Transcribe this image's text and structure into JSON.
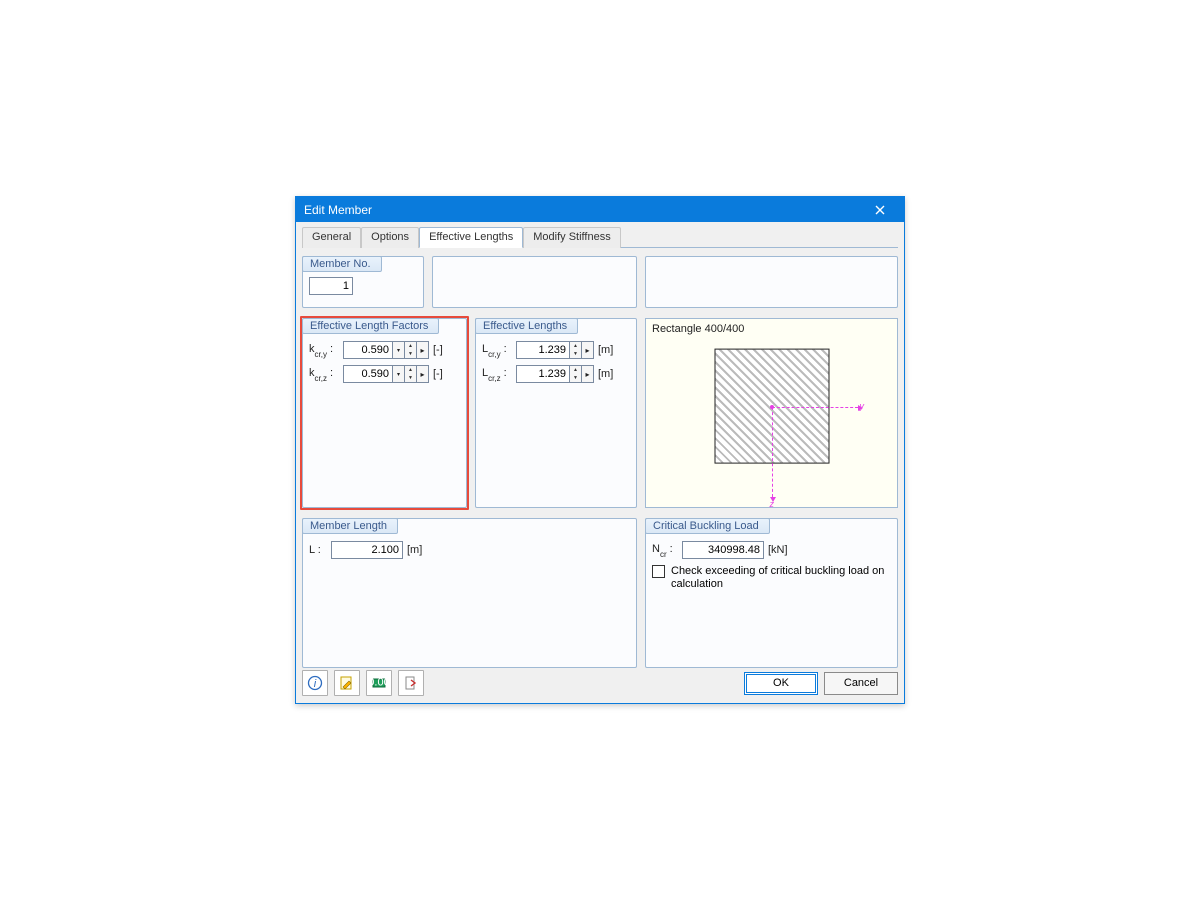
{
  "dialog": {
    "title": "Edit Member"
  },
  "tabs": {
    "general": "General",
    "options": "Options",
    "effective": "Effective Lengths",
    "modify": "Modify Stiffness"
  },
  "member_no": {
    "legend": "Member No.",
    "value": "1"
  },
  "factors": {
    "legend": "Effective Length Factors",
    "kcry": {
      "label": "k",
      "subscript": "cr,y",
      "colon": " :",
      "value": "0.590",
      "unit": "[-]"
    },
    "kcrz": {
      "label": "k",
      "subscript": "cr,z",
      "colon": " :",
      "value": "0.590",
      "unit": "[-]"
    }
  },
  "lengths": {
    "legend": "Effective Lengths",
    "lcry": {
      "label": "L",
      "subscript": "cr,y",
      "colon": " :",
      "value": "1.239",
      "unit": "[m]"
    },
    "lcrz": {
      "label": "L",
      "subscript": "cr,z",
      "colon": " :",
      "value": "1.239",
      "unit": "[m]"
    }
  },
  "preview": {
    "caption": "Rectangle 400/400",
    "y": "y",
    "z": "z"
  },
  "member_length": {
    "legend": "Member Length",
    "label": "L :",
    "value": "2.100",
    "unit": "[m]"
  },
  "buckling": {
    "legend": "Critical Buckling Load",
    "label": "N",
    "subscript": "cr",
    "colon": " :",
    "value": "340998.48",
    "unit": "[kN]",
    "check_label": "Check exceeding of critical buckling load on calculation"
  },
  "buttons": {
    "ok": "OK",
    "cancel": "Cancel"
  }
}
